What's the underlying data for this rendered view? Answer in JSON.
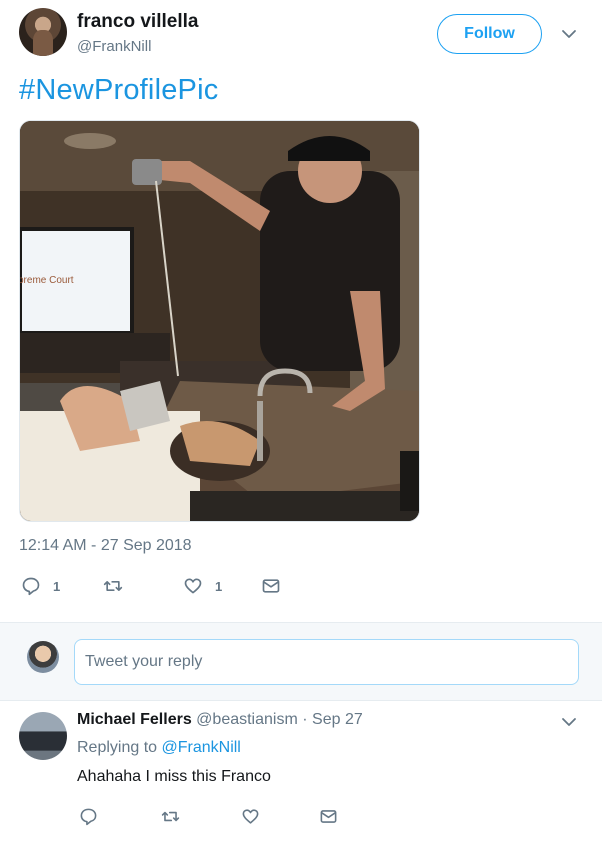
{
  "tweet": {
    "author_name": "franco villella",
    "author_handle": "@FrankNill",
    "follow_label": "Follow",
    "text": "#NewProfilePic",
    "photo_caption": "preme Court",
    "timestamp": "12:14 AM - 27 Sep 2018",
    "actions": {
      "reply_count": "1",
      "retweet_count": "",
      "like_count": "1"
    },
    "icons": [
      "reply-icon",
      "retweet-icon",
      "like-icon",
      "message-icon",
      "chevron-down-icon"
    ]
  },
  "reply_box": {
    "placeholder": "Tweet your reply"
  },
  "reply": {
    "author_name": "Michael Fellers",
    "author_handle": "@beastianism",
    "separator": "·",
    "date": "Sep 27",
    "replying_prefix": "Replying to",
    "replying_to": "@FrankNill",
    "text": "Ahahaha I miss this Franco"
  },
  "colors": {
    "accent": "#1da1f2",
    "link": "#1b95e0",
    "muted": "#657786",
    "text": "#14171a"
  }
}
